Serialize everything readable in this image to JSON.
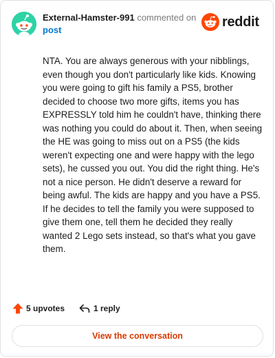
{
  "comment": {
    "username": "External-Hamster-991",
    "action_text": "commented on",
    "post_link": "post",
    "body": "NTA. You are always generous with your nibblings, even though you don't particularly like kids. Knowing you were going to gift his family a PS5, brother decided to choose two more gifts, items you has EXPRESSLY told him he couldn't have, thinking there was nothing you could do about it. Then, when seeing the HE was going to miss out on a PS5 (the kids weren't expecting one and were happy with the lego sets), he cussed you out. You did the right thing. He's not a nice person. He didn't deserve a reward for being awful. The kids are happy and you have a PS5. If he decides to tell the family you were supposed to give them one, tell them he decided they really wanted 2 Lego sets instead, so that's what you gave them."
  },
  "brand": {
    "name": "reddit",
    "icon": "reddit-snoo-icon"
  },
  "actions": {
    "upvotes_label": "5 upvotes",
    "reply_label": "1 reply",
    "upvote_icon": "upvote-arrow-icon",
    "reply_icon": "reply-arrow-icon"
  },
  "footer": {
    "view_conversation_label": "View the conversation"
  },
  "colors": {
    "accent": "#d93a00",
    "upvote": "#ff4500",
    "link": "#0079d3",
    "avatar_bg": "#2ed3a6"
  }
}
